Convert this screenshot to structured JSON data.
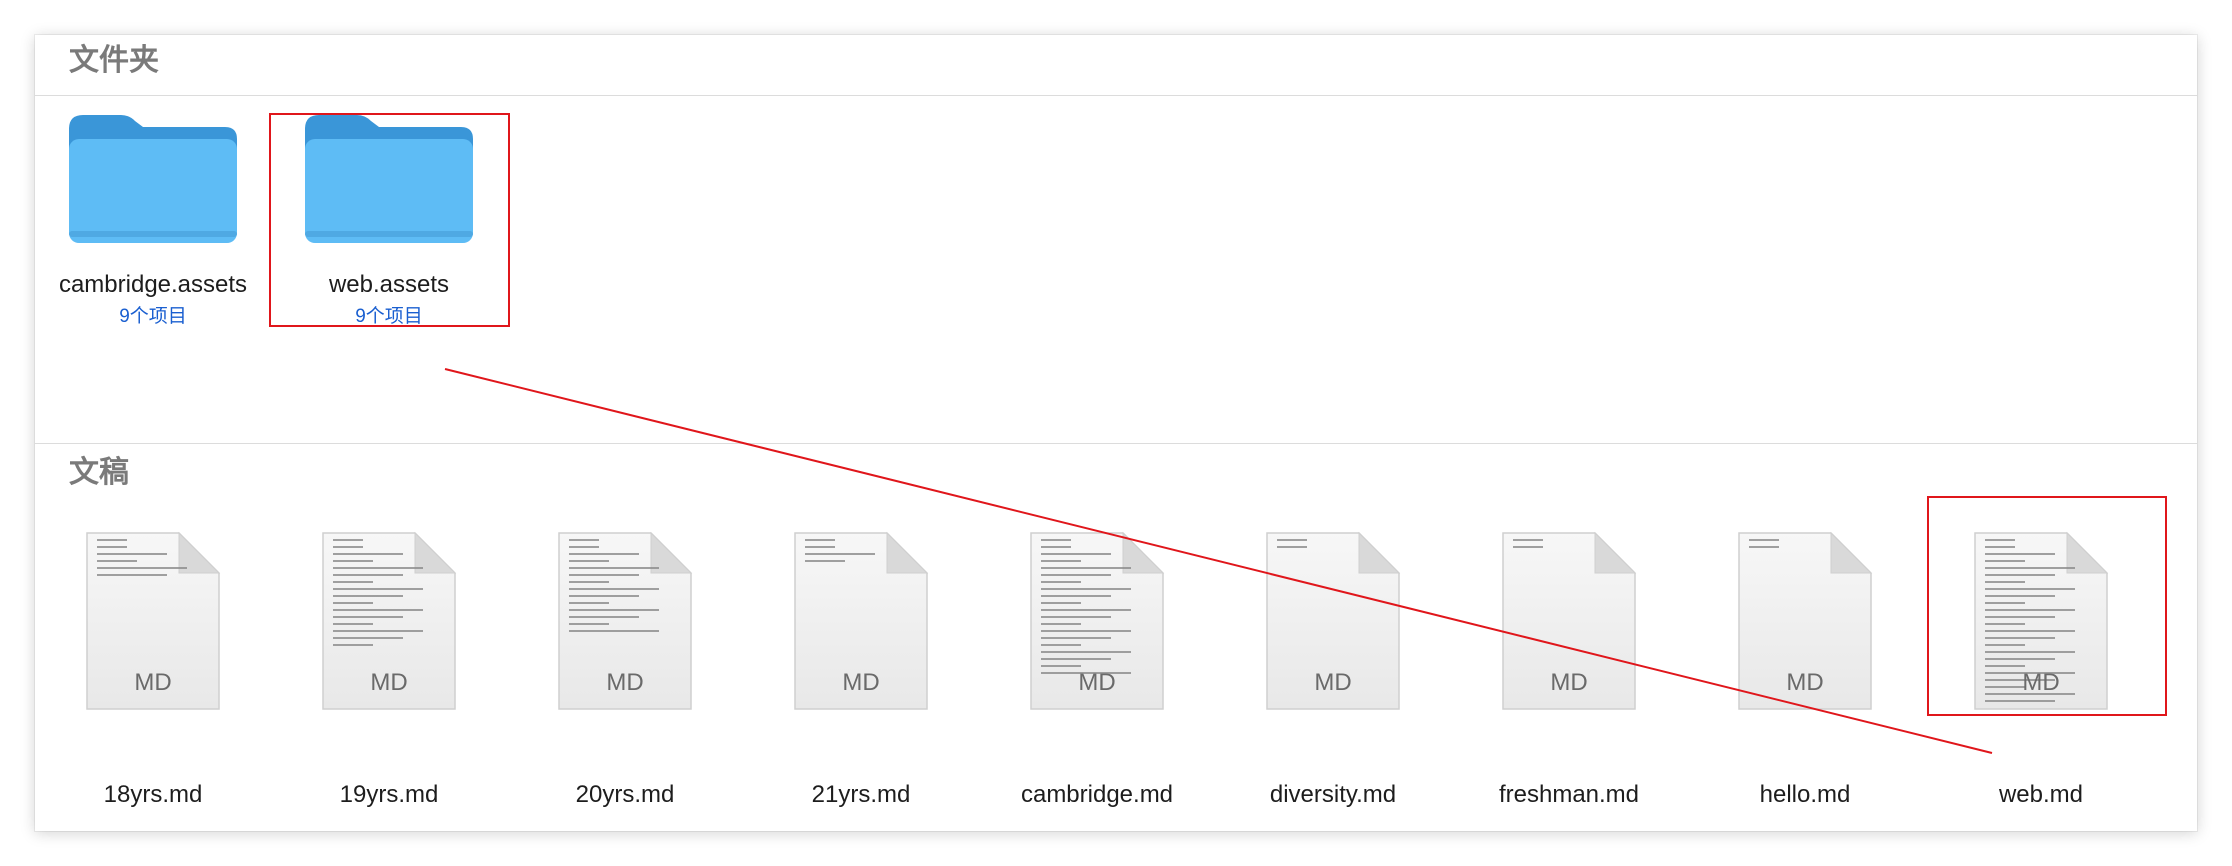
{
  "sections": {
    "folders": {
      "title": "文件夹"
    },
    "documents": {
      "title": "文稿"
    }
  },
  "folders": [
    {
      "name": "cambridge.assets",
      "count": "9个项目",
      "icon": "folder-icon"
    },
    {
      "name": "web.assets",
      "count": "9个项目",
      "icon": "folder-icon"
    }
  ],
  "documents": [
    {
      "name": "18yrs.md",
      "badge": "MD",
      "icon": "markdown-file-icon"
    },
    {
      "name": "19yrs.md",
      "badge": "MD",
      "icon": "markdown-file-icon"
    },
    {
      "name": "20yrs.md",
      "badge": "MD",
      "icon": "markdown-file-icon"
    },
    {
      "name": "21yrs.md",
      "badge": "MD",
      "icon": "markdown-file-icon"
    },
    {
      "name": "cambridge.md",
      "badge": "MD",
      "icon": "markdown-file-icon"
    },
    {
      "name": "diversity.md",
      "badge": "MD",
      "icon": "markdown-file-icon"
    },
    {
      "name": "freshman.md",
      "badge": "MD",
      "icon": "markdown-file-icon"
    },
    {
      "name": "hello.md",
      "badge": "MD",
      "icon": "markdown-file-icon"
    },
    {
      "name": "web.md",
      "badge": "MD",
      "icon": "markdown-file-icon"
    }
  ],
  "colors": {
    "folder_front": "#5ebcf5",
    "folder_back": "#3a96d8",
    "link_text": "#1a5fd0",
    "annotation": "#e0161b"
  }
}
